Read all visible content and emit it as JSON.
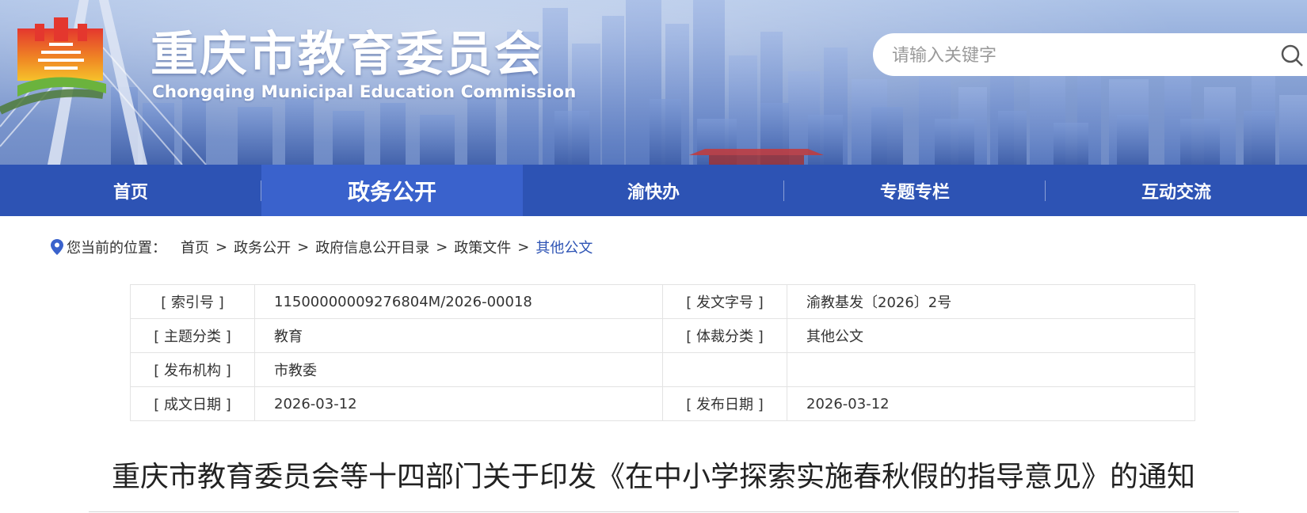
{
  "header": {
    "title_cn": "重庆市教育委员会",
    "title_en": "Chongqing Municipal Education Commission",
    "logo_icon": "emblem-logo-icon",
    "search": {
      "placeholder": "请输入关键字",
      "icon": "search-icon"
    }
  },
  "nav": {
    "items": [
      {
        "label": "首页",
        "active": false
      },
      {
        "label": "政务公开",
        "active": true
      },
      {
        "label": "渝快办",
        "active": false
      },
      {
        "label": "专题专栏",
        "active": false
      },
      {
        "label": "互动交流",
        "active": false
      }
    ]
  },
  "breadcrumb": {
    "icon": "location-pin-icon",
    "prefix": "您当前的位置：",
    "items": [
      "首页",
      "政务公开",
      "政府信息公开目录",
      "政策文件"
    ],
    "separator": ">",
    "current": "其他公文"
  },
  "meta": {
    "rows": [
      {
        "label1": "[ 索引号 ]",
        "value1": "11500000009276804M/2026-00018",
        "label2": "[ 发文字号 ]",
        "value2": "渝教基发〔2026〕2号"
      },
      {
        "label1": "[ 主题分类 ]",
        "value1": "教育",
        "label2": "[ 体裁分类 ]",
        "value2": "其他公文"
      },
      {
        "label1": "[ 发布机构 ]",
        "value1": "市教委",
        "label2": "",
        "value2": ""
      },
      {
        "label1": "[ 成文日期 ]",
        "value1": "2026-03-12",
        "label2": "[ 发布日期 ]",
        "value2": "2026-03-12"
      }
    ]
  },
  "article": {
    "title": "重庆市教育委员会等十四部门关于印发《在中小学探索实施春秋假的指导意见》的通知"
  },
  "colors": {
    "nav_bg": "#2d53b4",
    "nav_active": "#3a62cc",
    "link_current": "#2d53b4"
  }
}
